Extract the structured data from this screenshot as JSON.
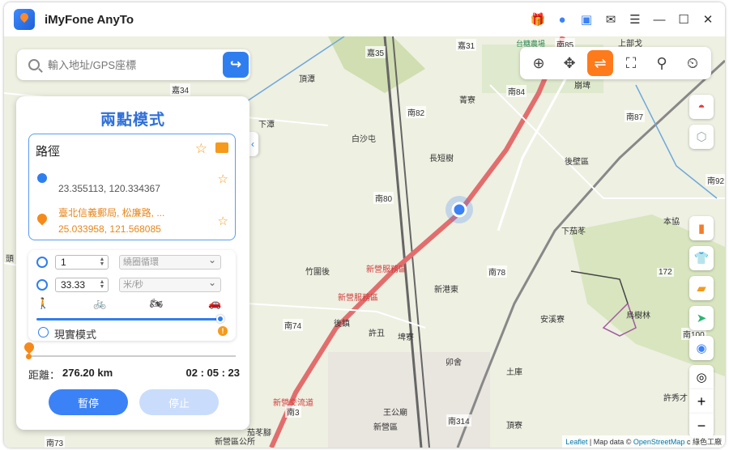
{
  "app": {
    "title": "iMyFone AnyTo"
  },
  "titlebar_icons": [
    "gift-icon",
    "user-icon",
    "toolbox-icon",
    "mail-icon",
    "menu-icon",
    "minimize-icon",
    "maximize-icon",
    "close-icon"
  ],
  "search": {
    "placeholder": "輸入地址/GPS座標",
    "go_icon": "arrow-right-icon"
  },
  "toolbar": {
    "tools": [
      "teleport-mode",
      "joystick-mode",
      "two-spot-mode",
      "multi-spot-mode",
      "jump-teleport-mode",
      "history-mode"
    ],
    "active": "two-spot-mode"
  },
  "panel": {
    "title": "兩點模式",
    "route_label": "路徑",
    "start_coords": "23.355113, 120.334367",
    "end_name": "臺北信義郵局, 松廉路, ...",
    "end_coords": "25.033958, 121.568085",
    "repeat_count": "1",
    "repeat_mode": "繞圈循環",
    "speed_value": "33.33",
    "speed_unit": "米/秒",
    "realistic_mode_label": "現實模式",
    "distance_label": "距離：",
    "distance_value": "276.20 km",
    "time_value": "02 : 05 : 23",
    "pause_button": "暫停",
    "stop_button": "停止",
    "speed_modes": [
      "walk-icon",
      "bike-icon",
      "motorcycle-icon",
      "car-icon"
    ],
    "speed_fraction": 1.0
  },
  "map_labels": [
    {
      "text": "嘉31",
      "kind": "road"
    },
    {
      "text": "嘉35",
      "kind": "road"
    },
    {
      "text": "嘉34",
      "kind": "road"
    },
    {
      "text": "頂潭",
      "kind": "place"
    },
    {
      "text": "下潭",
      "kind": "place"
    },
    {
      "text": "南82",
      "kind": "road"
    },
    {
      "text": "菁寮",
      "kind": "place"
    },
    {
      "text": "南84",
      "kind": "road"
    },
    {
      "text": "崩埤",
      "kind": "place"
    },
    {
      "text": "台糖農場",
      "kind": "green"
    },
    {
      "text": "南85",
      "kind": "road"
    },
    {
      "text": "上部戈",
      "kind": "place"
    },
    {
      "text": "白沙屯",
      "kind": "place"
    },
    {
      "text": "長短樹",
      "kind": "place"
    },
    {
      "text": "南87",
      "kind": "road"
    },
    {
      "text": "後壁區",
      "kind": "place"
    },
    {
      "text": "南80",
      "kind": "road"
    },
    {
      "text": "南92",
      "kind": "road"
    },
    {
      "text": "本協",
      "kind": "place"
    },
    {
      "text": "下茄苳",
      "kind": "place"
    },
    {
      "text": "竹圍後",
      "kind": "place"
    },
    {
      "text": "新營服務區",
      "kind": "red"
    },
    {
      "text": "新營服務區",
      "kind": "red"
    },
    {
      "text": "南78",
      "kind": "road"
    },
    {
      "text": "新港東",
      "kind": "place"
    },
    {
      "text": "172",
      "kind": "road"
    },
    {
      "text": "烏樹林",
      "kind": "place"
    },
    {
      "text": "安溪寮",
      "kind": "place"
    },
    {
      "text": "南74",
      "kind": "road"
    },
    {
      "text": "後鎮",
      "kind": "place"
    },
    {
      "text": "許丑",
      "kind": "place"
    },
    {
      "text": "埤寮",
      "kind": "place"
    },
    {
      "text": "南100",
      "kind": "road"
    },
    {
      "text": "卯舍",
      "kind": "place"
    },
    {
      "text": "土庫",
      "kind": "place"
    },
    {
      "text": "王公廟",
      "kind": "place"
    },
    {
      "text": "許秀才",
      "kind": "place"
    },
    {
      "text": "新營區",
      "kind": "place"
    },
    {
      "text": "南314",
      "kind": "road"
    },
    {
      "text": "頂寮",
      "kind": "place"
    },
    {
      "text": "茄苳腳",
      "kind": "place"
    },
    {
      "text": "南73",
      "kind": "road"
    },
    {
      "text": "頭",
      "kind": "place"
    },
    {
      "text": "新營交流道",
      "kind": "red"
    },
    {
      "text": "南3",
      "kind": "road"
    },
    {
      "text": "新營區公所",
      "kind": "place"
    }
  ],
  "side_tools": [
    "pokemon-icon",
    "cooldown-shield-icon",
    "book-icon",
    "shirt-icon",
    "import-folder-icon",
    "send-icon",
    "toggle-icon",
    "locate-icon",
    "zoom-in-icon",
    "zoom-out-icon"
  ],
  "attribution": {
    "leaflet": "Leaflet",
    "sep1": " | Map data © ",
    "osm": "OpenStreetMap",
    "tail": " c",
    "watermark": "綠色工廠"
  }
}
